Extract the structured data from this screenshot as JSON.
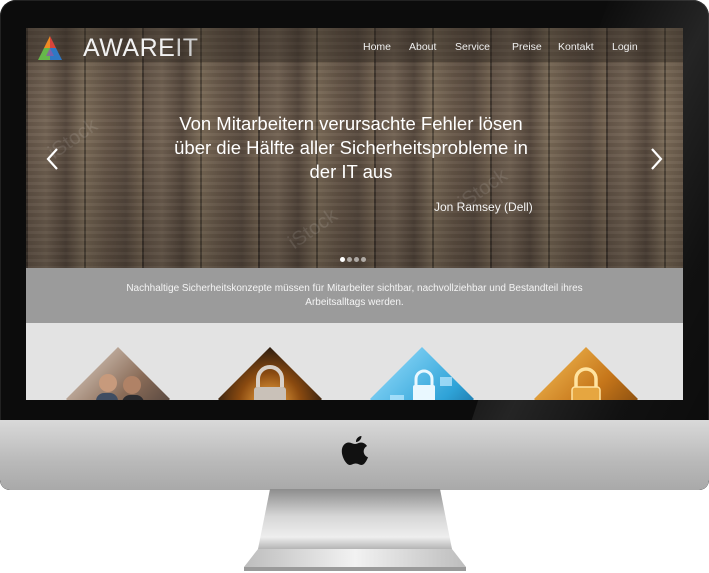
{
  "site": {
    "logo_text_main": "AWARE",
    "logo_text_accent": "IT"
  },
  "nav": {
    "items": [
      "Home",
      "About",
      "Service",
      "Preise",
      "Kontakt",
      "Login"
    ]
  },
  "hero": {
    "quote_line1": "Von Mitarbeitern verursachte Fehler lösen",
    "quote_line2": "über die Hälfte aller Sicherheitsprobleme in",
    "quote_line3": "der IT aus",
    "author": "Jon Ramsey (Dell)",
    "prev_icon": "chevron-left-icon",
    "next_icon": "chevron-right-icon",
    "slides": 4,
    "active_slide": 1
  },
  "tagline": {
    "line1": "Nachhaltige Sicherheitskonzepte müssen für Mitarbeiter sichtbar, nachvollziehbar und Bestandteil ihres",
    "line2": "Arbeitsalltags werden."
  },
  "tiles": [
    {
      "icon": "team-photo-icon"
    },
    {
      "icon": "padlock-circuit-icon"
    },
    {
      "icon": "digital-lock-icon"
    },
    {
      "icon": "gold-padlock-icon"
    }
  ],
  "colors": {
    "tagline_band": "#9b9b9b",
    "tiles_background": "#e3e3e3",
    "logo_orange": "#f08a24",
    "logo_red": "#d9443a",
    "logo_green": "#66b84a",
    "logo_blue": "#2f78c4"
  }
}
